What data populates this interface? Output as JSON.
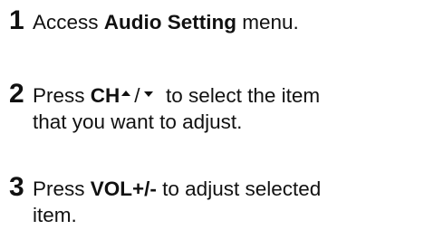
{
  "steps": [
    {
      "number": "1",
      "prefix": "Access ",
      "bold": "Audio Setting",
      "suffix": " menu."
    },
    {
      "number": "2",
      "prefix": "Press ",
      "bold": "CH",
      "separator": "/",
      "suffix": "  to select the item",
      "line2": "that you want to adjust.",
      "icons": [
        "triangle-up-icon",
        "triangle-down-icon"
      ]
    },
    {
      "number": "3",
      "prefix": "Press ",
      "bold": "VOL+/-",
      "suffix": " to adjust selected",
      "line2": "item."
    }
  ]
}
